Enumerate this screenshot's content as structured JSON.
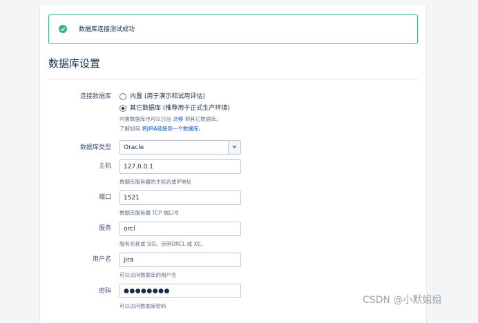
{
  "banner": {
    "message": "数据库连接测试成功",
    "accent_color": "#36B37E",
    "icon": "check-circle-icon"
  },
  "page_title": "数据库设置",
  "connection": {
    "label": "连接数据库",
    "options": [
      {
        "label": "内置 (用于演示和试用评估)",
        "checked": false
      },
      {
        "label": "其它数据库 (推荐用于正式生产环境)",
        "checked": true
      }
    ],
    "help_line1_prefix": "内置数据库也可以日后",
    "help_line1_link": "迁移",
    "help_line1_suffix": "到其它数据库。",
    "help_line2_prefix": "了解如何",
    "help_line2_link": "将JIRA链接到一个数据库",
    "help_line2_suffix": "。"
  },
  "db_type": {
    "label": "数据库类型",
    "selected": "Oracle"
  },
  "host": {
    "label": "主机",
    "value": "127.0.0.1",
    "help": "数据库服务器的主机名或IP地址"
  },
  "port": {
    "label": "端口",
    "value": "1521",
    "help": "数据库服务器 TCP 端口号"
  },
  "service": {
    "label": "服务",
    "value": "orcl",
    "help": "服务名称或 SID。示例ORCL 或 XE。"
  },
  "username": {
    "label": "用户名",
    "value": "jira",
    "help": "可以访问数据库的用户名"
  },
  "password": {
    "label": "密码",
    "value": "●●●●●●●●",
    "help": "可以访问数据库密码"
  },
  "watermark": "CSDN @小默姐姐",
  "colors": {
    "link": "#0052CC",
    "success_border": "#2FB67C"
  }
}
